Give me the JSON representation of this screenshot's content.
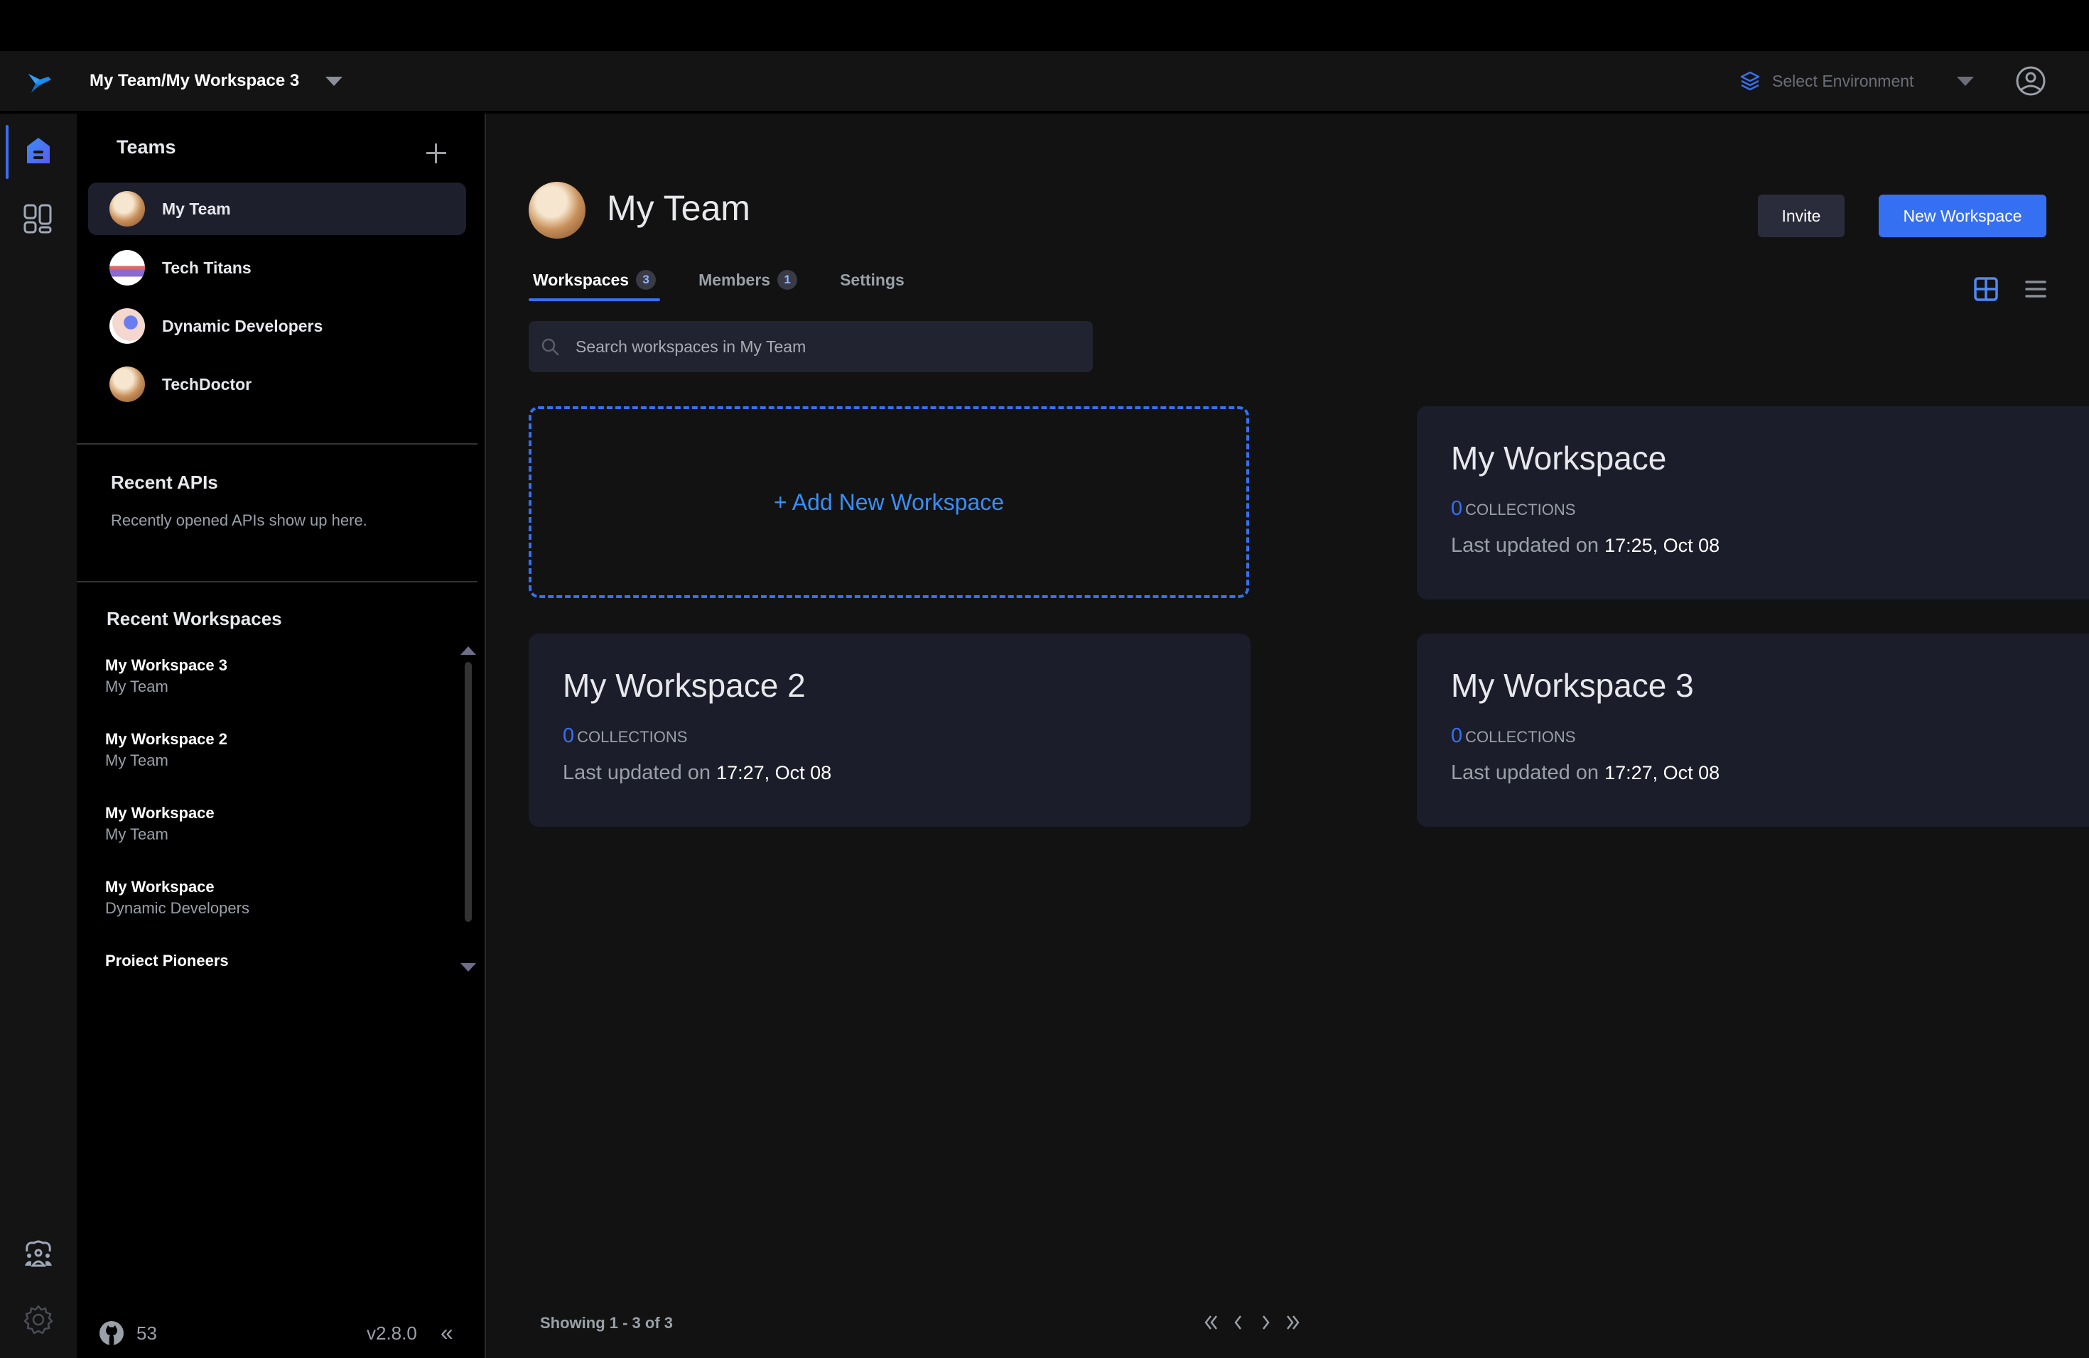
{
  "header": {
    "workspace_path": "My Team/My Workspace 3",
    "environment_placeholder": "Select Environment"
  },
  "rail": {
    "items": [
      {
        "name": "home",
        "active": true
      },
      {
        "name": "collections",
        "active": false
      },
      {
        "name": "community",
        "active": false
      },
      {
        "name": "settings",
        "active": false
      }
    ]
  },
  "sidebar": {
    "teams_title": "Teams",
    "teams": [
      {
        "name": "My Team",
        "active": true
      },
      {
        "name": "Tech Titans",
        "active": false
      },
      {
        "name": "Dynamic Developers",
        "active": false
      },
      {
        "name": "TechDoctor",
        "active": false
      }
    ],
    "recent_apis_title": "Recent APIs",
    "recent_apis_empty": "Recently opened APIs show up here.",
    "recent_workspaces_title": "Recent Workspaces",
    "recent_workspaces": [
      {
        "name": "My Workspace 3",
        "team": "My Team"
      },
      {
        "name": "My Workspace 2",
        "team": "My Team"
      },
      {
        "name": "My Workspace",
        "team": "My Team"
      },
      {
        "name": "My Workspace",
        "team": "Dynamic Developers"
      },
      {
        "name": "Proiect Pioneers",
        "team": ""
      }
    ],
    "footer": {
      "github_stars": "53",
      "version": "v2.8.0",
      "collapse_glyph": "«"
    }
  },
  "main": {
    "team_name": "My Team",
    "invite_label": "Invite",
    "new_workspace_label": "New Workspace",
    "tabs": [
      {
        "label": "Workspaces",
        "count": "3",
        "active": true
      },
      {
        "label": "Members",
        "count": "1",
        "active": false
      },
      {
        "label": "Settings",
        "count": null,
        "active": false
      }
    ],
    "view_mode": "grid",
    "search_placeholder": "Search workspaces in My Team",
    "search_value": "",
    "add_workspace_label": "+ Add New Workspace",
    "workspaces": [
      {
        "name": "My Workspace",
        "collections": "0",
        "collections_label": "COLLECTIONS",
        "updated_prefix": "Last updated on",
        "updated_at": "17:25, Oct 08"
      },
      {
        "name": "My Workspace 2",
        "collections": "0",
        "collections_label": "COLLECTIONS",
        "updated_prefix": "Last updated on",
        "updated_at": "17:27, Oct 08"
      },
      {
        "name": "My Workspace 3",
        "collections": "0",
        "collections_label": "COLLECTIONS",
        "updated_prefix": "Last updated on",
        "updated_at": "17:27, Oct 08"
      }
    ],
    "pagination": {
      "showing": "Showing 1 - 3 of 3"
    }
  },
  "colors": {
    "accent": "#3670f2",
    "link": "#3a8ef5",
    "card_bg": "#1c1d2a",
    "active_item_bg": "#1e1f2c",
    "muted_text": "#9aa0a8"
  }
}
